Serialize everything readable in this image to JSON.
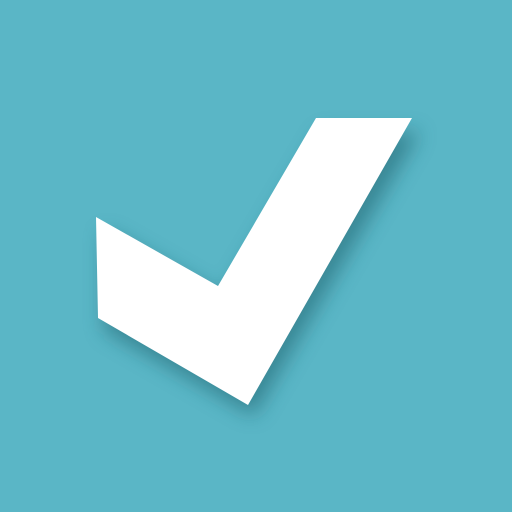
{
  "icon": {
    "name": "checkmark-icon",
    "colors": {
      "background": "#5ab6c6",
      "mark": "#ffffff",
      "shadow": "#1f5f6b"
    }
  }
}
